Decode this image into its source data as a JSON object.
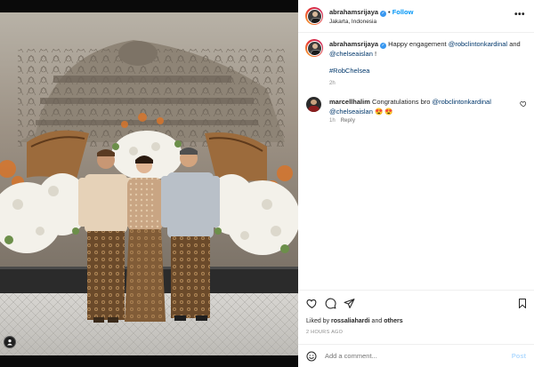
{
  "post": {
    "author": "abrahamsrijaya",
    "follow_label": "Follow",
    "separator": "•",
    "location": "Jakarta, Indonesia",
    "more_icon": "ellipsis-icon",
    "verified_icon": "verified-badge-icon"
  },
  "caption": {
    "author": "abrahamsrijaya",
    "text_before": "Happy engagement ",
    "mention_1": "@robclintonkardinal",
    "text_between": " and ",
    "mention_2": "@chelseaislan",
    "text_after": " !",
    "hashtag": "#RobChelsea",
    "time": "2h"
  },
  "comments": [
    {
      "author": "marcellhalim",
      "text_before": "Congratulations bro ",
      "mention_1": "@robclintonkardinal",
      "mention_2": "@chelseaislan",
      "emoji": "😍 😍",
      "time": "1h",
      "reply_label": "Reply"
    }
  ],
  "actions": {
    "icons": [
      "heart-icon",
      "comment-icon",
      "share-icon",
      "bookmark-icon"
    ]
  },
  "likes": {
    "prefix": "Liked by ",
    "user": "rossaliahardi",
    "middle": " and ",
    "others": "others"
  },
  "timestamp": "2 HOURS AGO",
  "add_comment": {
    "placeholder": "Add a comment...",
    "post_label": "Post"
  },
  "colors": {
    "link": "#00376b",
    "follow": "#0095f6",
    "post_disabled": "#b3dbff",
    "muted": "#8e8e8e"
  }
}
